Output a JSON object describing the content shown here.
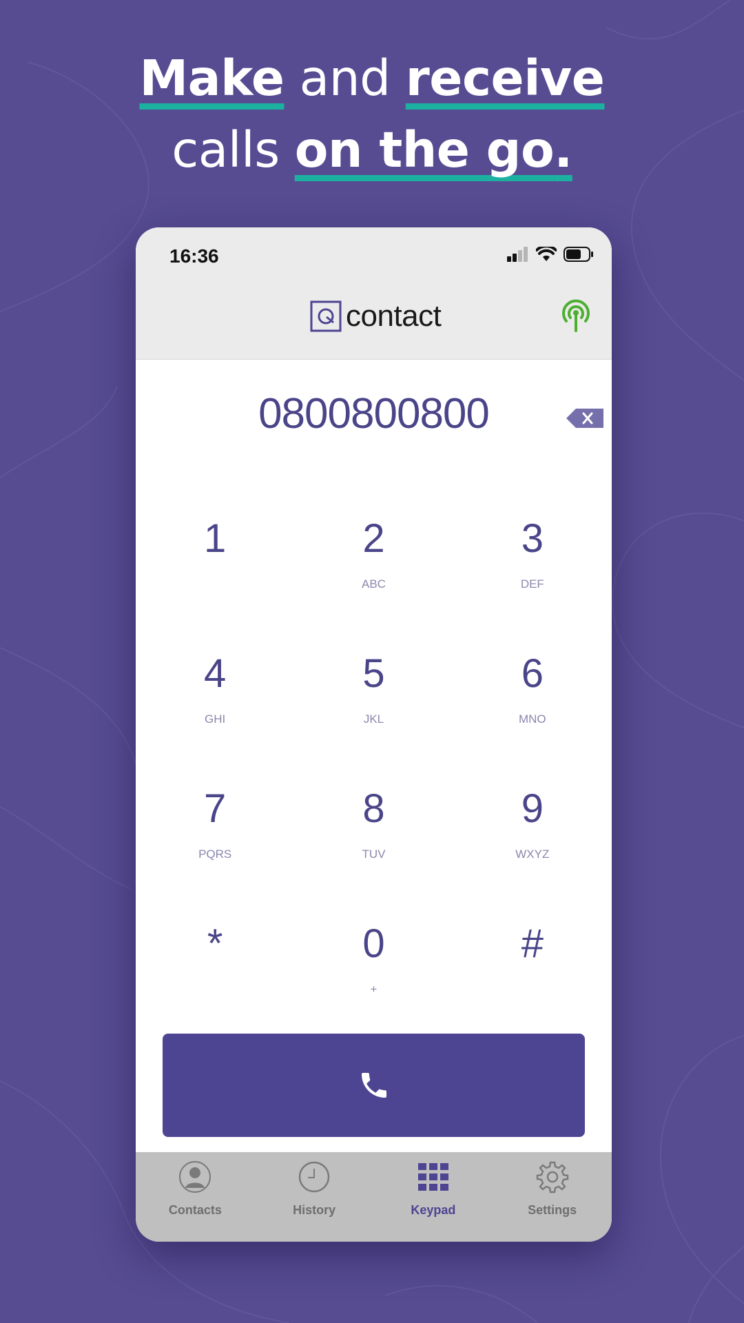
{
  "headline": {
    "line1": {
      "w1": "Make",
      "w2": "and",
      "w3": "receive"
    },
    "line2": {
      "w1": "calls",
      "w2": "on the go",
      "w3": "."
    }
  },
  "status_bar": {
    "time": "16:36"
  },
  "header": {
    "logo_text": "contact",
    "broadcast_icon": "broadcast-icon"
  },
  "dialer": {
    "number": "0800800800",
    "backspace_icon": "backspace-icon"
  },
  "keypad": {
    "keys": [
      {
        "digit": "1",
        "letters": ""
      },
      {
        "digit": "2",
        "letters": "ABC"
      },
      {
        "digit": "3",
        "letters": "DEF"
      },
      {
        "digit": "4",
        "letters": "GHI"
      },
      {
        "digit": "5",
        "letters": "JKL"
      },
      {
        "digit": "6",
        "letters": "MNO"
      },
      {
        "digit": "7",
        "letters": "PQRS"
      },
      {
        "digit": "8",
        "letters": "TUV"
      },
      {
        "digit": "9",
        "letters": "WXYZ"
      },
      {
        "digit": "*",
        "letters": ""
      },
      {
        "digit": "0",
        "letters": "+"
      },
      {
        "digit": "#",
        "letters": ""
      }
    ]
  },
  "call_button": {
    "icon": "phone-icon"
  },
  "tab_bar": {
    "tabs": [
      {
        "label": "Contacts",
        "icon": "person-icon",
        "active": false
      },
      {
        "label": "History",
        "icon": "clock-icon",
        "active": false
      },
      {
        "label": "Keypad",
        "icon": "keypad-icon",
        "active": true
      },
      {
        "label": "Settings",
        "icon": "gear-icon",
        "active": false
      }
    ]
  },
  "colors": {
    "background": "#574c92",
    "accent_underline": "#1cb0a0",
    "primary": "#4d4492",
    "signal_green": "#4caf2f"
  }
}
